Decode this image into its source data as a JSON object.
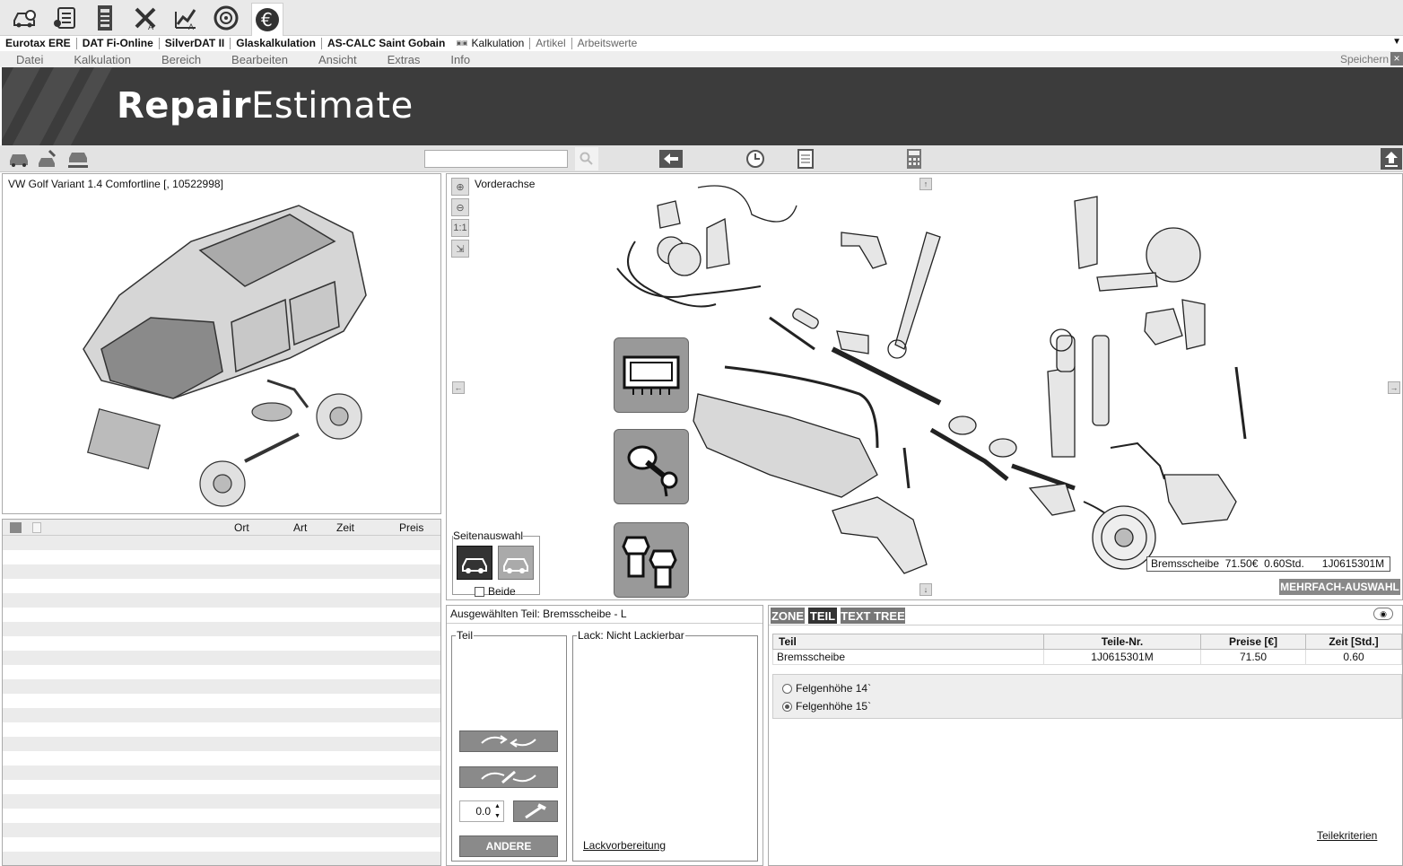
{
  "toolbar": {
    "icons": [
      "car-search-icon",
      "document-list-icon",
      "barcode-document-icon",
      "tools-icon",
      "chart-icon",
      "wheel-icon",
      "euro-icon"
    ]
  },
  "app_tabs": [
    "Eurotax ERE",
    "DAT Fi-Online",
    "SilverDAT II",
    "Glaskalkulation",
    "AS-CALC Saint Gobain",
    "Kalkulation",
    "Artikel",
    "Arbeitswerte"
  ],
  "menu": [
    "Datei",
    "Kalkulation",
    "Bereich",
    "Bearbeiten",
    "Ansicht",
    "Extras",
    "Info"
  ],
  "save_label": "Speichern",
  "brand": {
    "bold": "Repair",
    "light": "Estimate"
  },
  "search": {
    "value": "",
    "placeholder": ""
  },
  "vehicle": {
    "title": "VW Golf Variant 1.4 Comfortline [, 10522998]"
  },
  "list": {
    "headers": {
      "ort": "Ort",
      "art": "Art",
      "zeit": "Zeit",
      "preis": "Preis"
    }
  },
  "diagram": {
    "area_name": "Vorderachse",
    "zoom_fit_label": "1:1",
    "side_select": {
      "legend": "Seitenauswahl",
      "both_label": "Beide",
      "both_checked": false
    },
    "tooltip": "Bremsscheibe  71.50€  0.60Std.      1J0615301M",
    "multi_select_label": "MEHRFACH-AUSWAHL"
  },
  "selected": {
    "title": "Ausgewählten Teil: Bremsscheibe - L",
    "part_legend": "Teil",
    "paint_legend": "Lack: Nicht Lackierbar",
    "qty_value": "0.0",
    "other_label": "ANDERE",
    "paint_prep_link": "Lackvorbereitung"
  },
  "detail": {
    "tabs": [
      "ZONE",
      "TEIL",
      "TEXT TREE"
    ],
    "active_tab": "TEIL",
    "table": {
      "headers": [
        "Teil",
        "Teile-Nr.",
        "Preise [€]",
        "Zeit [Std.]"
      ],
      "rows": [
        [
          "Bremsscheibe",
          "1J0615301M",
          "71.50",
          "0.60"
        ]
      ]
    },
    "options": [
      {
        "label": "Felgenhöhe 14`",
        "selected": false
      },
      {
        "label": "Felgenhöhe 15`",
        "selected": true
      }
    ],
    "criteria_link": "Teilekriterien"
  }
}
